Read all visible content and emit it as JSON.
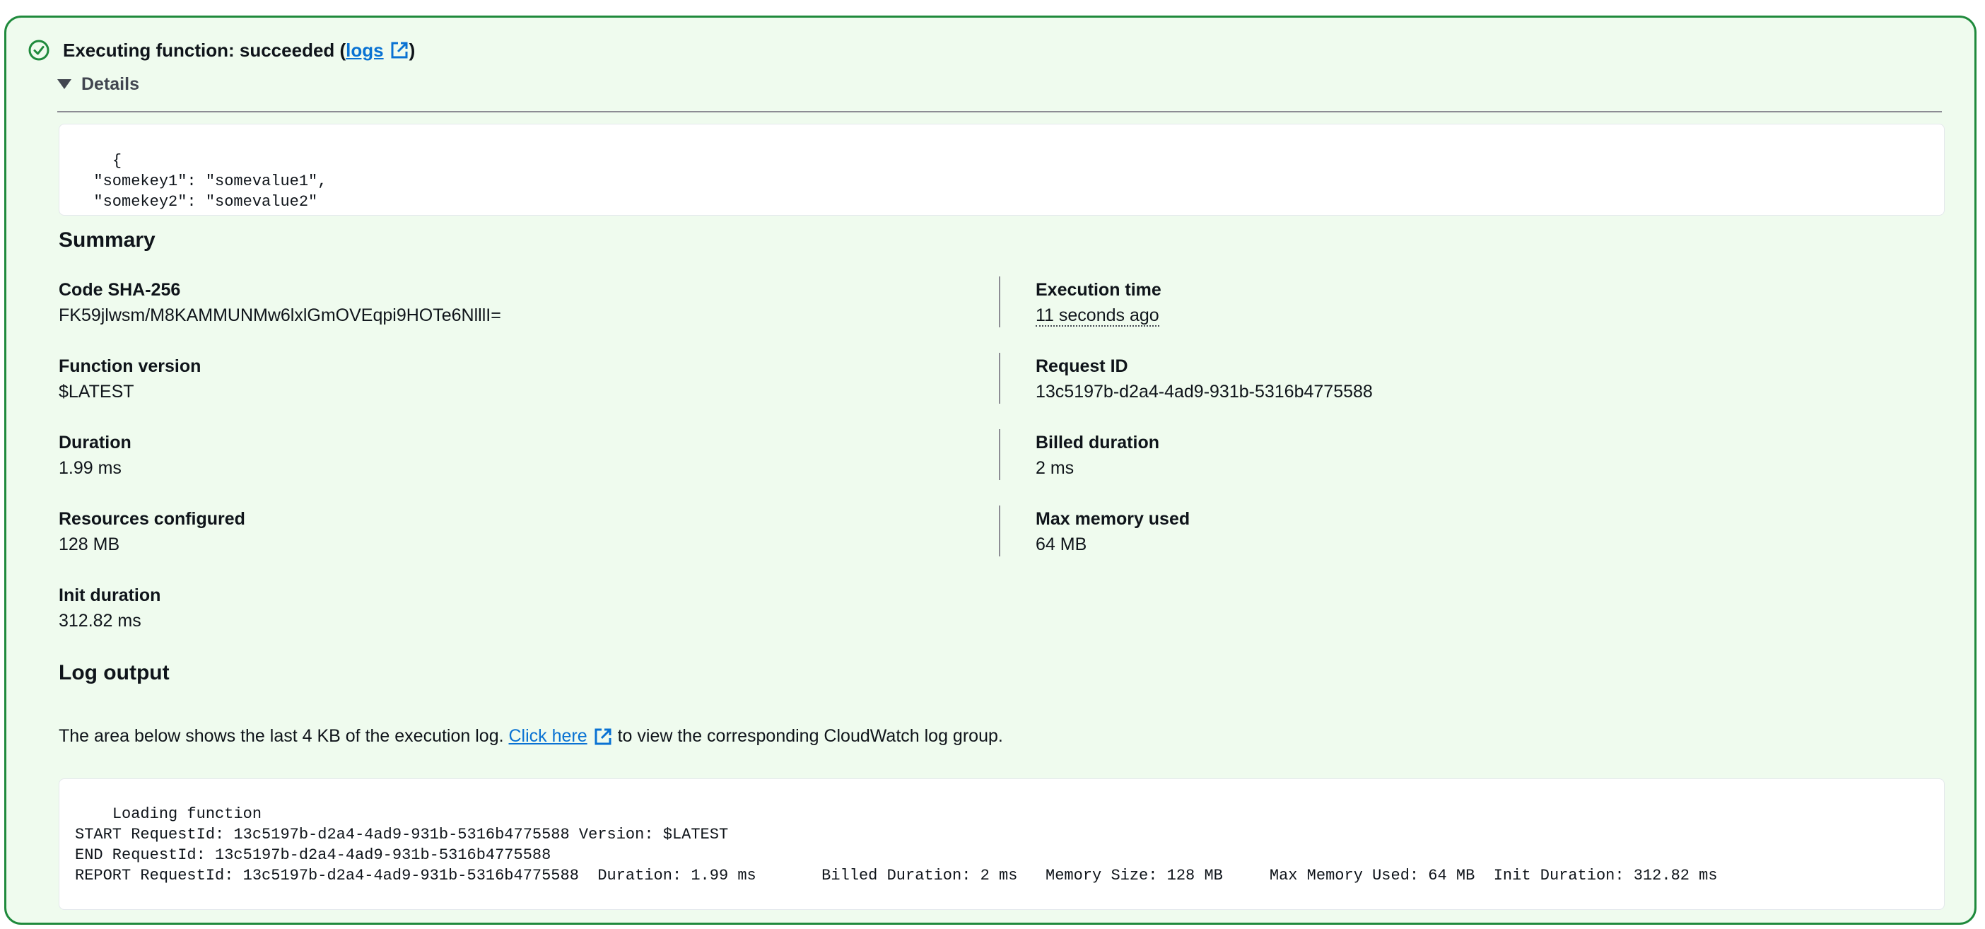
{
  "status": {
    "text": "Executing function: succeeded (",
    "link_label": "logs",
    "close_paren": ")",
    "icon": "check-circle-icon",
    "color": "#1f8a3c"
  },
  "details": {
    "label": "Details",
    "payload": "{\n  \"somekey1\": \"somevalue1\",\n  \"somekey2\": \"somevalue2\"\n}"
  },
  "summary": {
    "title": "Summary",
    "left": [
      {
        "label": "Code SHA-256",
        "value": "FK59jlwsm/M8KAMMUNMw6lxlGmOVEqpi9HOTe6NlllI="
      },
      {
        "label": "Function version",
        "value": "$LATEST"
      },
      {
        "label": "Duration",
        "value": "1.99 ms"
      },
      {
        "label": "Resources configured",
        "value": "128 MB"
      },
      {
        "label": "Init duration",
        "value": "312.82 ms"
      }
    ],
    "right": [
      {
        "label": "Execution time",
        "value": "11 seconds ago"
      },
      {
        "label": "Request ID",
        "value": "13c5197b-d2a4-4ad9-931b-5316b4775588"
      },
      {
        "label": "Billed duration",
        "value": "2 ms"
      },
      {
        "label": "Max memory used",
        "value": "64 MB"
      }
    ]
  },
  "log_output": {
    "title": "Log output",
    "description_before": "The area below shows the last 4 KB of the execution log. ",
    "link_label": "Click here",
    "description_after": " to view the corresponding CloudWatch log group.",
    "log_text": "Loading function\nSTART RequestId: 13c5197b-d2a4-4ad9-931b-5316b4775588 Version: $LATEST\nEND RequestId: 13c5197b-d2a4-4ad9-931b-5316b4775588\nREPORT RequestId: 13c5197b-d2a4-4ad9-931b-5316b4775588  Duration: 1.99 ms       Billed Duration: 2 ms   Memory Size: 128 MB     Max Memory Used: 64 MB  Init Duration: 312.82 ms"
  },
  "colors": {
    "link": "#0972d3",
    "panel_background": "#effbee",
    "panel_border": "#1f8a3c"
  }
}
